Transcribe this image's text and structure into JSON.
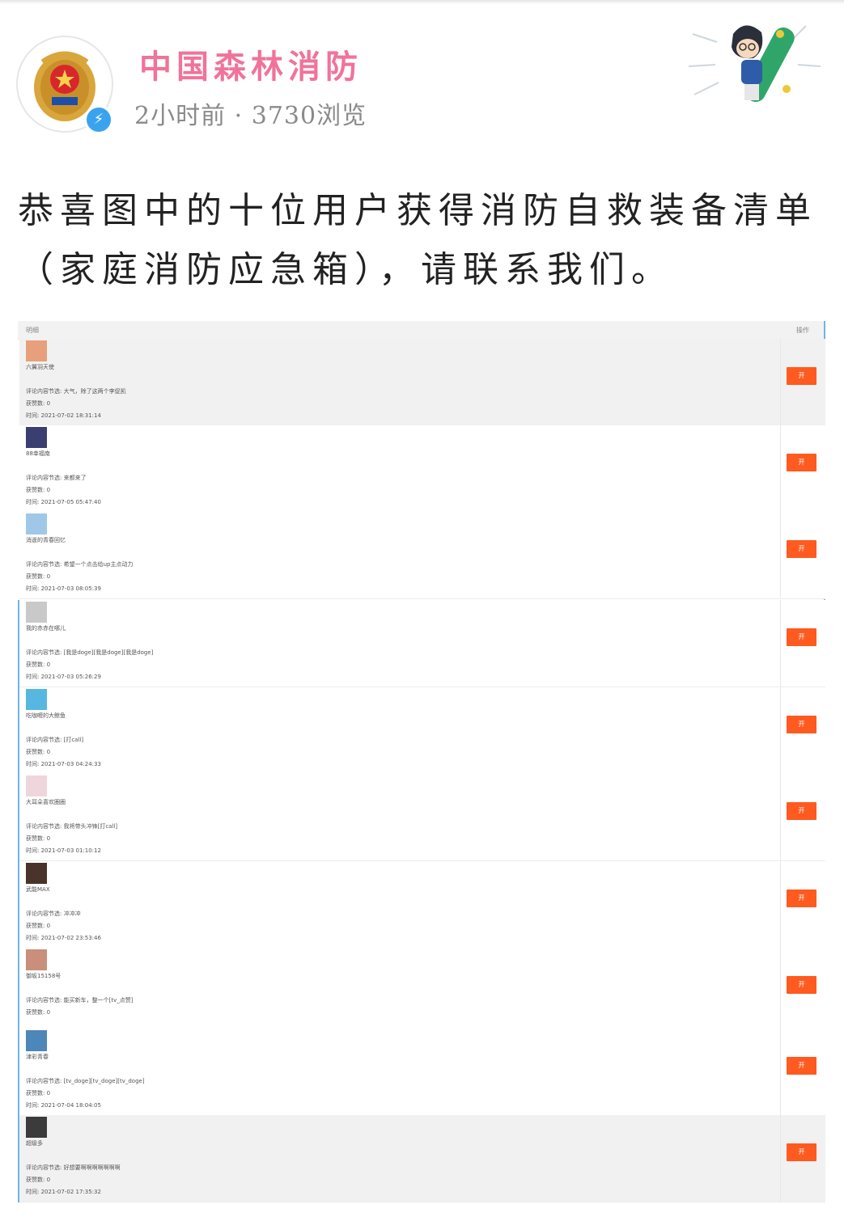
{
  "post": {
    "author": "中国森林消防",
    "time_ago": "2小时前",
    "separator": "·",
    "views": "3730浏览",
    "title_line1": "恭喜图中的十位用户获得消防自救装备清单",
    "title_line2": "（家庭消防应急箱），请联系我们。"
  },
  "table": {
    "col_detail": "明细",
    "col_action": "操作",
    "comment_prefix": "评论内容节选:",
    "likes_prefix": "获赞数:",
    "time_prefix": "时间:",
    "action_label": "开",
    "rows": [
      {
        "user": "六翼羽天使",
        "comment": "大气，除了这两个李促凯",
        "likes": "0",
        "time": "2021-07-02 18:31:14",
        "avatar_color": "#e7a07b"
      },
      {
        "user": "88幸福南",
        "comment": "来都来了",
        "likes": "0",
        "time": "2021-07-05 05:47:40",
        "avatar_color": "#3a3f72"
      },
      {
        "user": "消逝的青春回忆",
        "comment": "希望一个点击给up主点动力",
        "likes": "0",
        "time": "2021-07-03 08:05:39",
        "avatar_color": "#9fc8e8"
      },
      {
        "user": "我的赤赤在哪儿",
        "comment": "[我是doge][我是doge][我是doge]",
        "likes": "0",
        "time": "2021-07-03 05:26:29",
        "avatar_color": "#c9c9c9"
      },
      {
        "user": "吃咖喱的大鲸鱼",
        "comment": "[打call]",
        "likes": "0",
        "time": "2021-07-03 04:24:33",
        "avatar_color": "#58b7e0"
      },
      {
        "user": "大耳朵喜欢圈圈",
        "comment": "我将带头冲锋[打call]",
        "likes": "0",
        "time": "2021-07-03 01:10:12",
        "avatar_color": "#efd6dc"
      },
      {
        "user": "武能MAX",
        "comment": "冲冲冲",
        "likes": "0",
        "time": "2021-07-02 23:53:46",
        "avatar_color": "#4a3328"
      },
      {
        "user": "御坂15158号",
        "comment": "能买新车，整一个[tv_点赞]",
        "likes": "0",
        "time": "",
        "avatar_color": "#c98f7a"
      },
      {
        "user": "津彩青春",
        "comment": "[tv_doge][tv_doge][tv_doge]",
        "likes": "0",
        "time": "2021-07-04 18:04:05",
        "avatar_color": "#4d86b8"
      },
      {
        "user": "超级多",
        "comment": "好想要啊啊啊啊啊啊啊",
        "likes": "0",
        "time": "2021-07-02 17:35:32",
        "avatar_color": "#3b3b3b"
      }
    ]
  },
  "colors": {
    "author": "#f0739a",
    "meta": "#8a8a8a",
    "action_button": "#ff5a1f",
    "verify_badge": "#3aa3ee"
  },
  "icons": {
    "verify": "lightning-badge-icon",
    "emblem": "fire-rescue-emblem",
    "decoration": "cartoon-skateboard-sticker"
  }
}
